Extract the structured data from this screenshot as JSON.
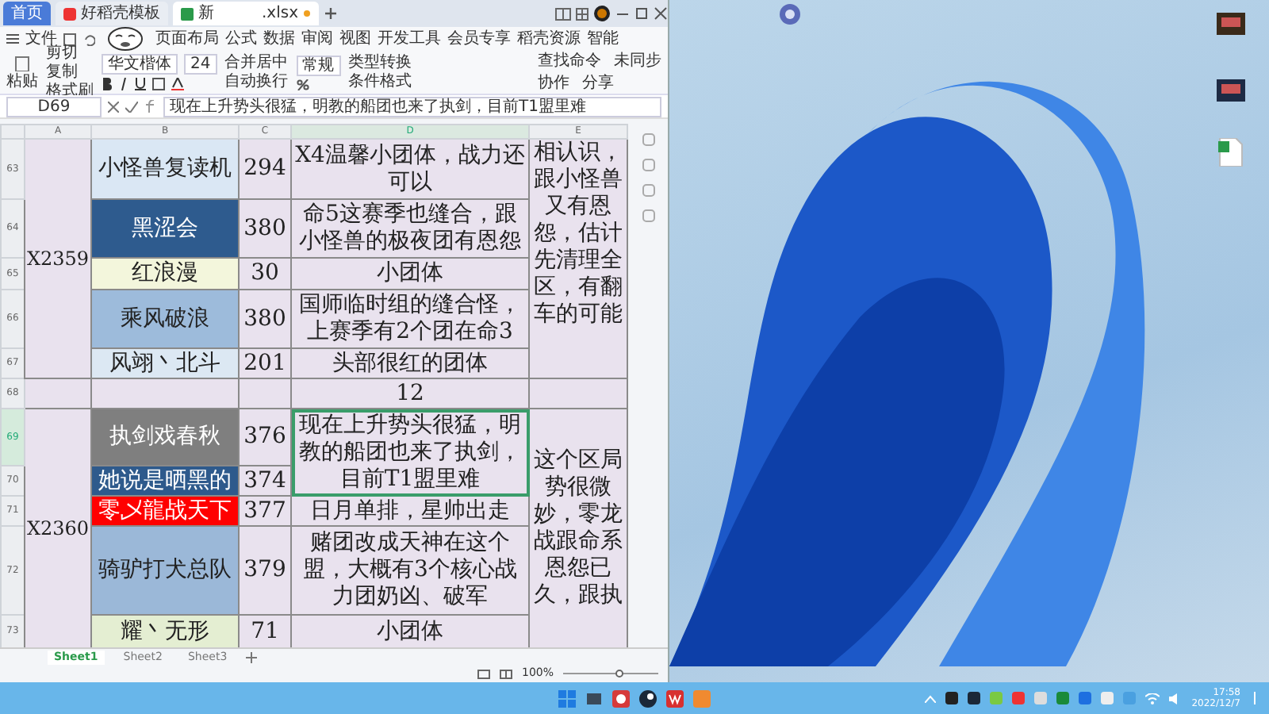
{
  "app": {
    "doc_tabs": [
      {
        "label": "首页",
        "kind": "home",
        "selected": false
      },
      {
        "label": "好稻壳模板",
        "kind": "docer",
        "selected": false
      },
      {
        "label": "新",
        "tail": ".xlsx",
        "kind": "sheet",
        "selected": true
      }
    ],
    "menu": {
      "file": "文件",
      "tabs": [
        "页面布局",
        "公式",
        "数据",
        "审阅",
        "视图",
        "开发工具",
        "会员专享",
        "稻壳资源",
        "智能"
      ],
      "tools": [
        "查找命令",
        "未同步",
        "协作",
        "分享"
      ]
    },
    "ribbon": {
      "paste": "粘贴",
      "clipboard": [
        "剪切",
        "复制",
        "格式刷"
      ],
      "font": "华文楷体",
      "size": "24",
      "align": [
        "合并居中",
        "自动换行"
      ],
      "number_format": "常规",
      "more": [
        "类型转换",
        "条件格式"
      ]
    },
    "name_box": "D69",
    "formula": "现在上升势头很猛，明教的船团也来了执剑，目前T1盟里难",
    "columns": [
      {
        "label": "A",
        "selected": false
      },
      {
        "label": "B",
        "selected": false
      },
      {
        "label": "C",
        "selected": false
      },
      {
        "label": "D",
        "selected": true
      },
      {
        "label": "E",
        "selected": false
      }
    ],
    "blocks": [
      {
        "kind": "group",
        "server": "X2359",
        "remark": "相认识，跟小怪兽又有恩怨，估计先清理全区，有翻车的可能",
        "rows": [
          {
            "number": "63",
            "team": "小怪兽复读机",
            "color": "#dae7f4",
            "score": "294",
            "note": "X4温馨小团体，战力还可以",
            "selected": false
          },
          {
            "number": "64",
            "team": "黑涩会",
            "color": "#2e5b8e",
            "score": "380",
            "note": "命5这赛季也缝合，跟小怪兽的极夜团有恩怨",
            "selected": false
          },
          {
            "number": "65",
            "team": "红浪漫",
            "color": "#f3f6dc",
            "score": "30",
            "note": "小团体",
            "selected": false
          },
          {
            "number": "66",
            "team": "乘风破浪",
            "color": "#9dbbdb",
            "score": "380",
            "note": "国师临时组的缝合怪，上赛季有2个团在命3",
            "selected": false
          },
          {
            "number": "67",
            "team": "风翊丶北斗",
            "color": "#dce8f3",
            "score": "201",
            "note": "头部很红的团体",
            "selected": false
          }
        ]
      },
      {
        "kind": "separator",
        "number": "68",
        "note": "12",
        "selected": false
      },
      {
        "kind": "group",
        "server": "X2360",
        "remark": "这个区局势很微妙，零龙战跟命系恩怨已久，跟执",
        "rows": [
          {
            "number": "69",
            "team": "执剑戏春秋",
            "color": "#7f7f7f",
            "score": "376",
            "note": "现在上升势头很猛，明教的船团也来了执剑，目前T1盟里难",
            "selected": true
          },
          {
            "number": "70",
            "team": "她说是晒黑的",
            "color": "#2e5a8c",
            "score": "374",
            "selected": false
          },
          {
            "number": "71",
            "team": "零乄龍战天下",
            "color": "#ff0000",
            "score": "377",
            "note": "日月单排，星帅出走",
            "selected": false
          },
          {
            "number": "72",
            "team": "骑驴打犬总队",
            "color": "#9bb8d8",
            "score": "379",
            "note": "赌团改成天神在这个盟，大概有3个核心战力团奶凶、破军",
            "selected": false
          },
          {
            "number": "73",
            "team": "耀丶无形",
            "color": "#e4eed2",
            "score": "71",
            "note": "小团体",
            "selected": false
          }
        ]
      }
    ],
    "sheets": [
      {
        "label": "Sheet1",
        "selected": true
      },
      {
        "label": "Sheet2",
        "selected": false
      },
      {
        "label": "Sheet3",
        "selected": false
      }
    ],
    "zoom": {
      "label": "100%",
      "level": 0.6
    }
  },
  "taskbar": {
    "time": "17:58",
    "date": "2022/12/7"
  }
}
